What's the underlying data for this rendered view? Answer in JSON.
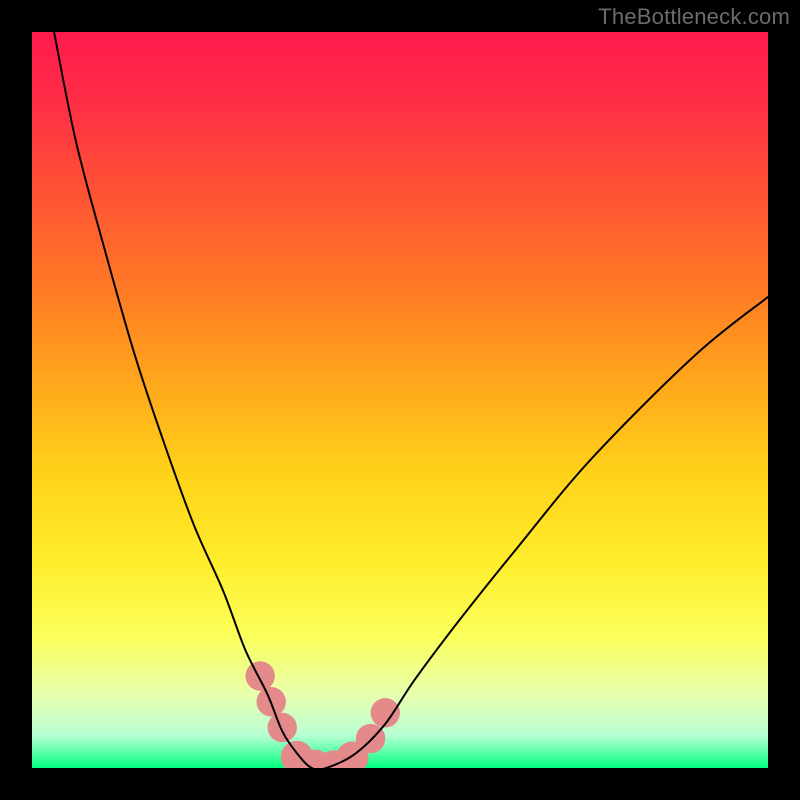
{
  "watermark": "TheBottleneck.com",
  "gradient_stops": [
    {
      "offset": 0.0,
      "color": "#ff1a4d"
    },
    {
      "offset": 0.1,
      "color": "#ff2f45"
    },
    {
      "offset": 0.22,
      "color": "#ff5334"
    },
    {
      "offset": 0.35,
      "color": "#ff7a25"
    },
    {
      "offset": 0.48,
      "color": "#ffa81b"
    },
    {
      "offset": 0.6,
      "color": "#ffd21a"
    },
    {
      "offset": 0.72,
      "color": "#ffed2b"
    },
    {
      "offset": 0.82,
      "color": "#fbff5a"
    },
    {
      "offset": 0.9,
      "color": "#e8ffae"
    },
    {
      "offset": 0.955,
      "color": "#b9ffd4"
    },
    {
      "offset": 0.985,
      "color": "#40ff9e"
    },
    {
      "offset": 1.0,
      "color": "#00ff7f"
    }
  ],
  "chart_data": {
    "type": "line",
    "title": "",
    "xlabel": "",
    "ylabel": "",
    "xlim": [
      0,
      100
    ],
    "ylim": [
      0,
      100
    ],
    "grid": false,
    "series": [
      {
        "name": "bottleneck-curve",
        "x": [
          3,
          6,
          10,
          14,
          18,
          22,
          26,
          29,
          32,
          34,
          36,
          38,
          40,
          44,
          48,
          52,
          58,
          66,
          76,
          90,
          100
        ],
        "values": [
          100,
          85,
          70,
          56,
          44,
          33,
          24,
          16,
          10,
          5,
          2,
          0,
          0,
          2,
          6,
          12,
          20,
          30,
          42,
          56,
          64
        ]
      }
    ],
    "markers": [
      {
        "name": "left-cluster-top",
        "x": 31.0,
        "y": 12.5,
        "r": 2.0
      },
      {
        "name": "left-cluster-mid",
        "x": 32.5,
        "y": 9.0,
        "r": 2.0
      },
      {
        "name": "left-cluster-low",
        "x": 34.0,
        "y": 5.5,
        "r": 2.0
      },
      {
        "name": "bottom-seg-a",
        "x": 36.0,
        "y": 1.5,
        "r": 2.2
      },
      {
        "name": "bottom-seg-b",
        "x": 38.5,
        "y": 0.3,
        "r": 2.2
      },
      {
        "name": "bottom-seg-c",
        "x": 41.0,
        "y": 0.2,
        "r": 2.2
      },
      {
        "name": "bottom-seg-d",
        "x": 43.5,
        "y": 1.4,
        "r": 2.2
      },
      {
        "name": "right-cluster-low",
        "x": 46.0,
        "y": 4.0,
        "r": 2.0
      },
      {
        "name": "right-cluster-top",
        "x": 48.0,
        "y": 7.5,
        "r": 2.0
      }
    ],
    "marker_color": "#e58a8a",
    "line_color": "#000000",
    "line_width": 2.0
  }
}
